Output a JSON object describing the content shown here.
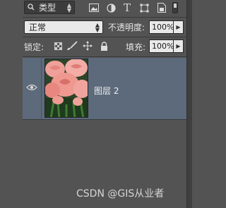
{
  "filter": {
    "icon": "search-icon",
    "label": "类型"
  },
  "filter_icons": [
    "image-filter-icon",
    "adjustment-filter-icon",
    "type-filter-icon",
    "shape-filter-icon",
    "smart-object-filter-icon"
  ],
  "blend": {
    "mode": "正常",
    "opacity_label": "不透明度:",
    "opacity_value": "100%"
  },
  "lock": {
    "label": "锁定:",
    "icons": [
      "lock-transparent-pixels-icon",
      "lock-image-pixels-icon",
      "lock-position-icon",
      "lock-all-icon"
    ],
    "fill_label": "填充:",
    "fill_value": "100%"
  },
  "layers": [
    {
      "name": "图层 2",
      "visible": true,
      "thumbnail": "rose-thumbnail"
    }
  ],
  "watermark": "CSDN @GIS从业者",
  "colors": {
    "panel": "#535353",
    "selected_row": "#5d6a7b"
  }
}
